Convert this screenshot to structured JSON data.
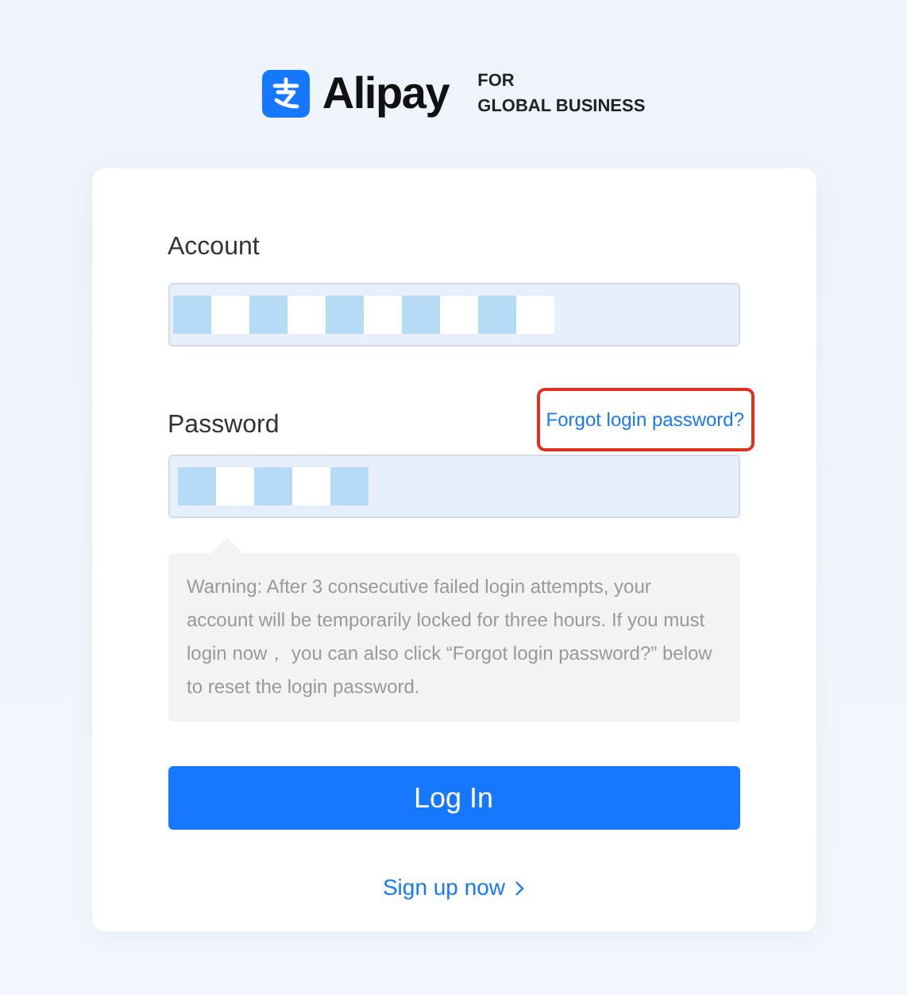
{
  "logo": {
    "wordmark": "Alipay",
    "tagline_top": "FOR",
    "tagline_bottom": "GLOBAL BUSINESS"
  },
  "form": {
    "account": {
      "label": "Account",
      "masked": true
    },
    "password": {
      "label": "Password",
      "masked": true,
      "forgot_link": "Forgot login password?",
      "forgot_highlighted": true
    },
    "warning": "Warning: After 3 consecutive failed login attempts, your account will be temporarily locked for three hours. If you must login now， you can also click “Forgot login password?” below to reset the login password.",
    "login_button": "Log In",
    "signup_link": "Sign up now"
  }
}
